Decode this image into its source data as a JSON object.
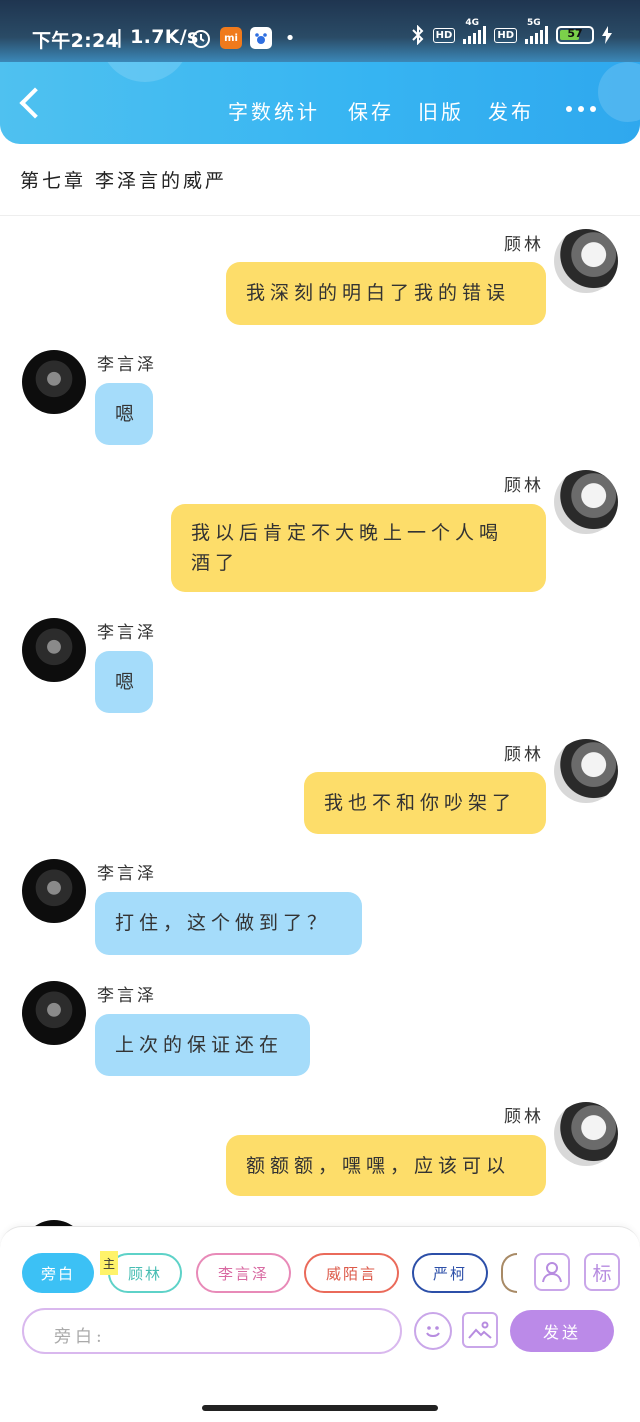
{
  "status_bar": {
    "time": "下午2:24",
    "net_speed": "| 1.7K/s",
    "hd1": "HD",
    "net1": "4G",
    "hd2": "HD",
    "net2": "5G",
    "battery": "57"
  },
  "header": {
    "word_count": "字数统计",
    "save": "保存",
    "old_version": "旧版",
    "publish": "发布"
  },
  "chapter_title": "第七章 李泽言的威严",
  "messages": [
    {
      "name": "顾林",
      "text": "我深刻的明白了我的错误"
    },
    {
      "name": "李言泽",
      "text": "嗯"
    },
    {
      "name": "顾林",
      "text": "我以后肯定不大晚上一个人喝酒了"
    },
    {
      "name": "李言泽",
      "text": "嗯"
    },
    {
      "name": "顾林",
      "text": "我也不和你吵架了"
    },
    {
      "name": "李言泽",
      "text": "打住，这个做到了？"
    },
    {
      "name": "李言泽",
      "text": "上次的保证还在"
    },
    {
      "name": "顾林",
      "text": "额额额，嘿嘿，应该可以"
    }
  ],
  "roles": [
    {
      "label": "旁白"
    },
    {
      "label": "顾林",
      "tag": "主"
    },
    {
      "label": "李言泽"
    },
    {
      "label": "威陌言"
    },
    {
      "label": "严柯"
    }
  ],
  "composer": {
    "placeholder": "旁白:",
    "send": "发送",
    "mark": "标"
  },
  "colors": {
    "accent": "#3cc1f5",
    "mine_bubble": "#fddd6a",
    "other_bubble": "#a5dcfa",
    "send_button": "#bb8ae8"
  }
}
